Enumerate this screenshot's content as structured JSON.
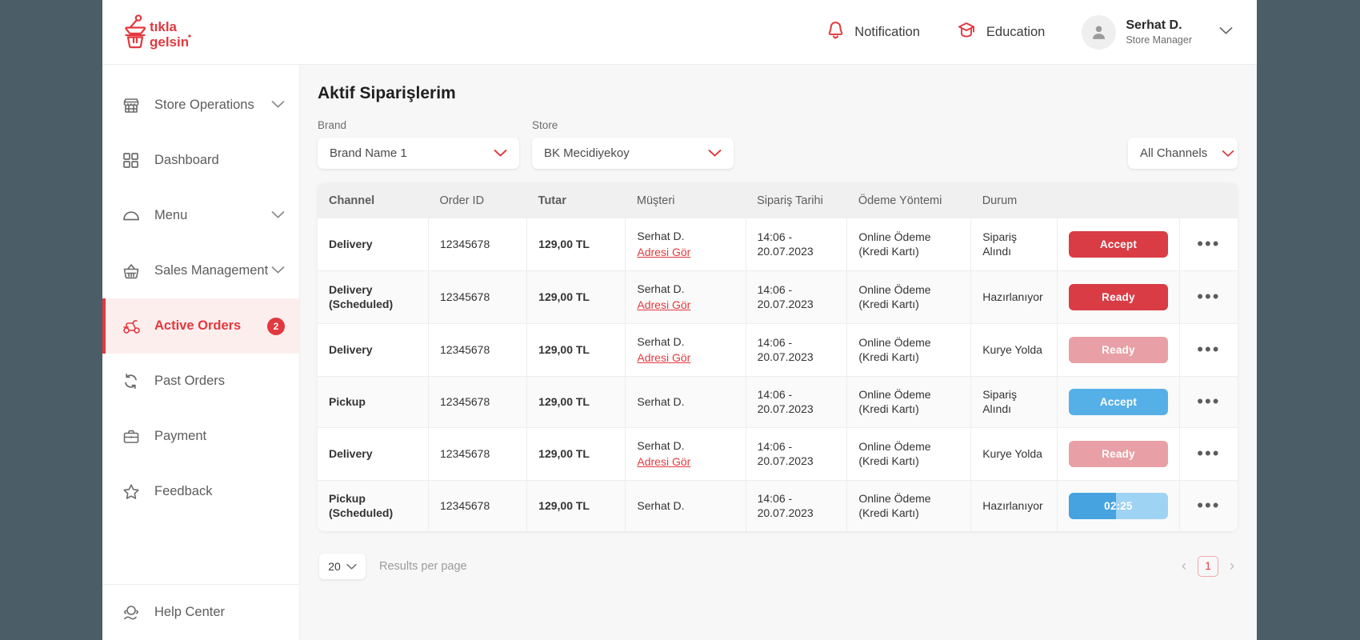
{
  "brand": {
    "accent": "#e2383f",
    "blue": "#56b0e8",
    "pink": "#e8a0a6"
  },
  "header": {
    "logo_text": "tıkla gelsin",
    "notification_label": "Notification",
    "education_label": "Education",
    "user_name": "Serhat D.",
    "user_role": "Store Manager"
  },
  "sidebar": {
    "items": [
      {
        "label": "Store Operations",
        "icon": "store-icon",
        "chevron": true,
        "badge": null,
        "active": false
      },
      {
        "label": "Dashboard",
        "icon": "dashboard-grid-icon",
        "chevron": false,
        "badge": null,
        "active": false
      },
      {
        "label": "Menu",
        "icon": "cloche-icon",
        "chevron": true,
        "badge": null,
        "active": false
      },
      {
        "label": "Sales Management",
        "icon": "basket-icon",
        "chevron": true,
        "badge": null,
        "active": false
      },
      {
        "label": "Active Orders",
        "icon": "scooter-icon",
        "chevron": false,
        "badge": "2",
        "active": true
      },
      {
        "label": "Past Orders",
        "icon": "refresh-icon",
        "chevron": false,
        "badge": null,
        "active": false
      },
      {
        "label": "Payment",
        "icon": "briefcase-icon",
        "chevron": false,
        "badge": null,
        "active": false
      },
      {
        "label": "Feedback",
        "icon": "star-icon",
        "chevron": false,
        "badge": null,
        "active": false
      }
    ],
    "help": {
      "label": "Help Center",
      "icon": "headset-icon"
    }
  },
  "main": {
    "title": "Aktif Siparişlerim",
    "filters": {
      "brand_label": "Brand",
      "brand_value": "Brand Name 1",
      "store_label": "Store",
      "store_value": "BK Mecidiyekoy",
      "channel_value": "All Channels"
    },
    "table": {
      "columns": [
        "Channel",
        "Order ID",
        "Tutar",
        "Müşteri",
        "Sipariş Tarihi",
        "Ödeme Yöntemi",
        "Durum",
        "",
        ""
      ],
      "address_link": "Adresi Gör",
      "menu_glyph": "•••",
      "rows": [
        {
          "channel": "Delivery",
          "order_id": "12345678",
          "amount": "129,00 TL",
          "customer": "Serhat D.",
          "has_address": true,
          "date": "14:06 - 20.07.2023",
          "payment": "Online Ödeme (Kredi Kartı)",
          "status": "Sipariş Alındı",
          "action_label": "Accept",
          "action_style": "btn-accept-red"
        },
        {
          "channel": "Delivery (Scheduled)",
          "order_id": "12345678",
          "amount": "129,00 TL",
          "customer": "Serhat D.",
          "has_address": true,
          "date": "14:06 - 20.07.2023",
          "payment": "Online Ödeme (Kredi Kartı)",
          "status": "Hazırlanıyor",
          "action_label": "Ready",
          "action_style": "btn-ready-red"
        },
        {
          "channel": "Delivery",
          "order_id": "12345678",
          "amount": "129,00 TL",
          "customer": "Serhat D.",
          "has_address": true,
          "date": "14:06 - 20.07.2023",
          "payment": "Online Ödeme (Kredi Kartı)",
          "status": "Kurye Yolda",
          "action_label": "Ready",
          "action_style": "btn-ready-pink"
        },
        {
          "channel": "Pickup",
          "order_id": "12345678",
          "amount": "129,00 TL",
          "customer": "Serhat D.",
          "has_address": false,
          "date": "14:06 - 20.07.2023",
          "payment": "Online Ödeme (Kredi Kartı)",
          "status": "Sipariş Alındı",
          "action_label": "Accept",
          "action_style": "btn-accept-blue"
        },
        {
          "channel": "Delivery",
          "order_id": "12345678",
          "amount": "129,00 TL",
          "customer": "Serhat D.",
          "has_address": true,
          "date": "14:06 - 20.07.2023",
          "payment": "Online Ödeme (Kredi Kartı)",
          "status": "Kurye Yolda",
          "action_label": "Ready",
          "action_style": "btn-ready-pink"
        },
        {
          "channel": "Pickup (Scheduled)",
          "order_id": "12345678",
          "amount": "129,00 TL",
          "customer": "Serhat D.",
          "has_address": false,
          "date": "14:06 - 20.07.2023",
          "payment": "Online Ödeme (Kredi Kartı)",
          "status": "Hazırlanıyor",
          "action_label": "02:25",
          "action_style": "btn-timer"
        }
      ]
    },
    "footer": {
      "per_page_value": "20",
      "per_page_label": "Results per page",
      "prev_glyph": "‹",
      "next_glyph": "›",
      "current_page": "1"
    }
  }
}
